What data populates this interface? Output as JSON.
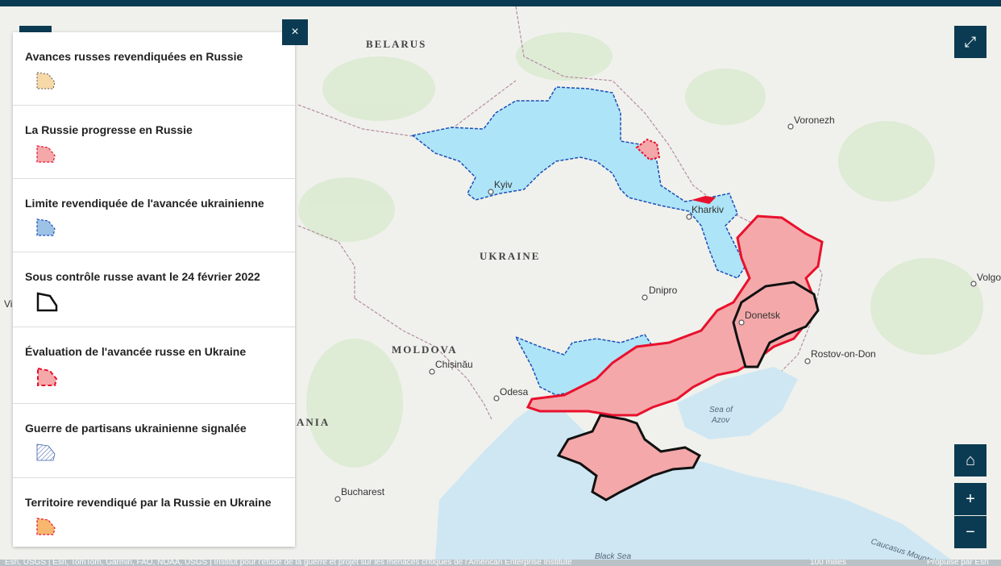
{
  "legend": {
    "items": [
      {
        "label": "Avances russes revendiquées en Russie"
      },
      {
        "label": "La Russie progresse en Russie"
      },
      {
        "label": "Limite revendiquée de l'avancée ukrainienne"
      },
      {
        "label": "Sous contrôle russe avant le 24 février 2022"
      },
      {
        "label": "Évaluation de l'avancée russe en Ukraine"
      },
      {
        "label": "Guerre de partisans ukrainienne signalée"
      },
      {
        "label": "Territoire revendiqué par la Russie en Ukraine"
      }
    ],
    "close_label": "×"
  },
  "map": {
    "countries": {
      "belarus": "BELARUS",
      "ukraine": "UKRAINE",
      "moldova": "MOLDOVA",
      "romania": "ANIA"
    },
    "cities": {
      "kyiv": "Kyiv",
      "kharkiv": "Kharkiv",
      "voronezh": "Voronezh",
      "dnipro": "Dnipro",
      "donetsk": "Donetsk",
      "rostov": "Rostov-on-Don",
      "chisinau": "Chișinău",
      "odesa": "Odesa",
      "bucharest": "Bucharest",
      "volgo": "Volgo",
      "vi": "Vi"
    },
    "seas": {
      "azov1": "Sea of",
      "azov2": "Azov",
      "black": "Black Sea",
      "caucasus": "Caucasus Mountains"
    }
  },
  "controls": {
    "fullscreen": "⤢",
    "home": "⌂",
    "zoom_in": "+",
    "zoom_out": "−"
  },
  "attribution": {
    "text": "Esri, USGS | Esri, TomTom, Garmin, FAO, NOAA, USGS | Institut pour l'étude de la guerre et projet sur les menaces critiques de l'American Enterprise Institute",
    "scale": "100 milles",
    "powered": "Propulsé par Esri"
  },
  "colors": {
    "russian_advance": "#f4a8aa",
    "russian_border": "#e8112d",
    "ukraine_advance": "#aee4f7",
    "ukraine_border": "#1a4fb8",
    "header": "#0b3b52"
  }
}
